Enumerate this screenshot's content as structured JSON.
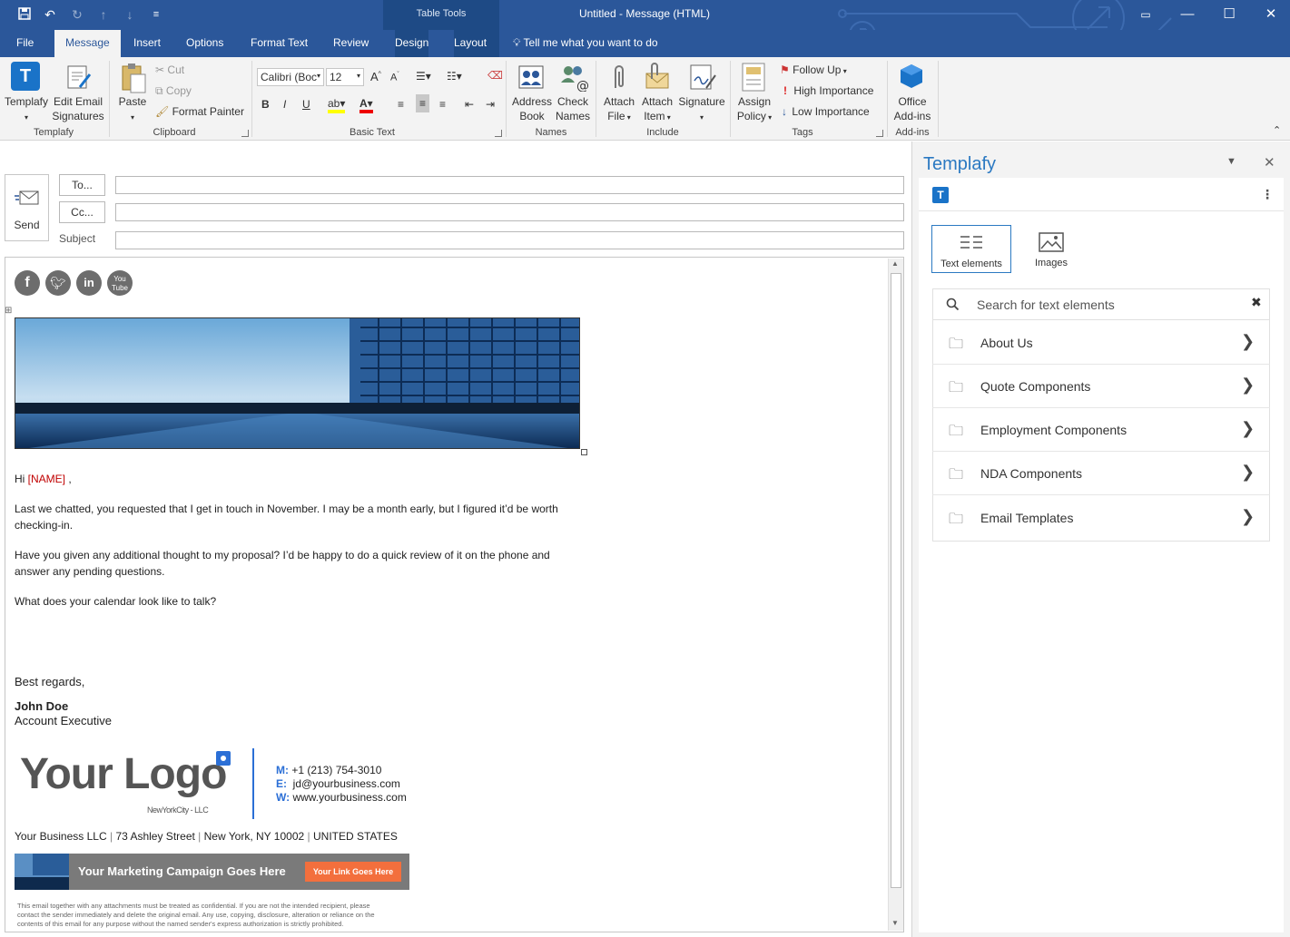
{
  "window": {
    "title": "Untitled  -  Message (HTML)",
    "context_tab_group": "Table Tools"
  },
  "tabs": [
    "File",
    "Message",
    "Insert",
    "Options",
    "Format Text",
    "Review",
    "Design",
    "Layout"
  ],
  "active_tab": "Message",
  "tell_me": "Tell me what you want to do",
  "ribbon": {
    "templafy_group": {
      "label": "Templafy",
      "templafy_btn": "Templafy",
      "edit_sig_line1": "Edit Email",
      "edit_sig_line2": "Signatures"
    },
    "clipboard_group": {
      "label": "Clipboard",
      "paste": "Paste",
      "cut": "Cut",
      "copy": "Copy",
      "format_painter": "Format Painter"
    },
    "basic_text_group": {
      "label": "Basic Text",
      "font": "Calibri (Boc",
      "size": "12",
      "bold": "B",
      "italic": "I",
      "underline": "U"
    },
    "names_group": {
      "label": "Names",
      "address_line1": "Address",
      "address_line2": "Book",
      "check_line1": "Check",
      "check_line2": "Names"
    },
    "include_group": {
      "label": "Include",
      "attach_file_line1": "Attach",
      "attach_file_line2": "File",
      "attach_item_line1": "Attach",
      "attach_item_line2": "Item",
      "signature": "Signature"
    },
    "tags_group": {
      "label": "Tags",
      "assign_line1": "Assign",
      "assign_line2": "Policy",
      "follow_up": "Follow Up",
      "high_importance": "High Importance",
      "low_importance": "Low Importance"
    },
    "addins_group": {
      "label": "Add-ins",
      "office_line1": "Office",
      "office_line2": "Add-ins"
    }
  },
  "compose": {
    "send": "Send",
    "to": "To...",
    "cc": "Cc...",
    "subject": "Subject",
    "to_value": "",
    "cc_value": "",
    "subject_value": ""
  },
  "email": {
    "greeting_prefix": "Hi ",
    "name_placeholder": "[NAME]",
    "greeting_suffix": " ,",
    "para1_line1": "Last we chatted, you requested that I get in touch in November. I may be a month early, but I figured it’d be worth",
    "para1_line2": "checking-in.",
    "para2_line1": "Have you given any additional thought to my proposal? I’d be happy to do a quick review of it on the phone and",
    "para2_line2": "answer any pending questions.",
    "para3": "What does your calendar look like to talk?",
    "closing": "Best regards,",
    "sender_name": "John Doe",
    "sender_title": "Account Executive",
    "logo_text": "Your Logo",
    "logo_sub": "NewYorkCity - LLC",
    "phone_label": "M:",
    "phone": "+1 (213) 754-3010",
    "email_label": "E:",
    "email": "jd@yourbusiness.com",
    "web_label": "W:",
    "web": "www.yourbusiness.com",
    "address_company": "Your Business LLC",
    "address_street": "73 Ashley Street",
    "address_city": "New York, NY 10002",
    "address_country": "UNITED STATES",
    "banner_text": "Your Marketing Campaign Goes Here",
    "banner_link": "Your Link Goes Here",
    "disclaimer_line1": "This email together with any attachments must be treated as confidential. If you are not the intended recipient, please",
    "disclaimer_line2": "contact the sender immediately and delete the original email. Any use, copying, disclosure, alteration or reliance on the",
    "disclaimer_line3": "contents of this email for any purpose without the named sender's express authorization is strictly prohibited."
  },
  "pane": {
    "title": "Templafy",
    "tab_text": "Text elements",
    "tab_images": "Images",
    "search_placeholder": "Search for text elements",
    "folders": [
      "About Us",
      "Quote Components",
      "Employment Components",
      "NDA Components",
      "Email Templates"
    ]
  },
  "colors": {
    "accent": "#2b579a",
    "templafy_blue": "#1a73c8",
    "name_red": "#c00000",
    "banner_orange": "#f36f3d"
  }
}
